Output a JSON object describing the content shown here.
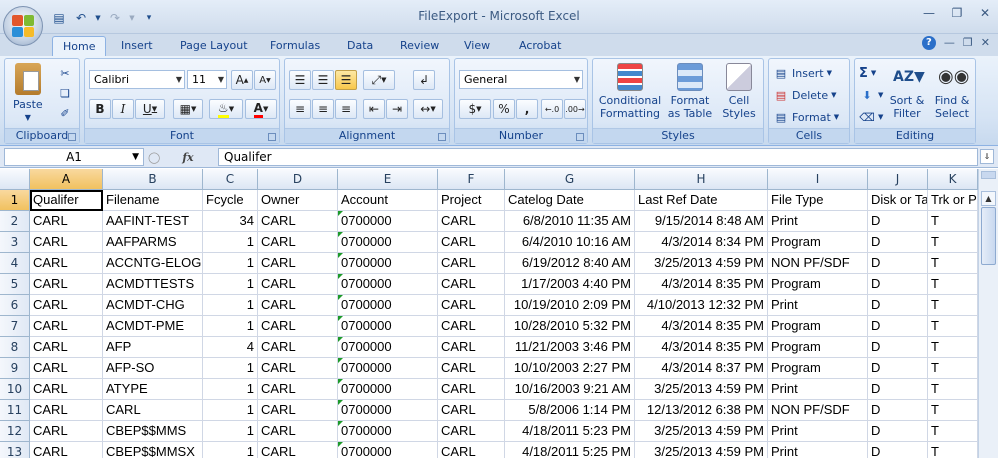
{
  "window": {
    "title": "FileExport - Microsoft Excel"
  },
  "ribbon_tabs": [
    "Home",
    "Insert",
    "Page Layout",
    "Formulas",
    "Data",
    "Review",
    "View",
    "Acrobat"
  ],
  "active_tab": "Home",
  "clipboard": {
    "paste": "Paste",
    "label": "Clipboard"
  },
  "font": {
    "family": "Calibri",
    "size": "11",
    "label": "Font"
  },
  "alignment": {
    "label": "Alignment"
  },
  "number": {
    "format": "General",
    "label": "Number",
    "currency": "$",
    "percent": "%",
    "comma": ","
  },
  "styles": {
    "conditional": "Conditional Formatting",
    "format_table": "Format as Table",
    "cell_styles": "Cell Styles",
    "label": "Styles"
  },
  "cells": {
    "insert": "Insert",
    "delete": "Delete",
    "format": "Format",
    "label": "Cells"
  },
  "editing": {
    "sum": "Σ",
    "sort": "Sort & Filter",
    "find": "Find & Select",
    "label": "Editing"
  },
  "formula_bar": {
    "name_box": "A1",
    "fx": "fx",
    "content": "Qualifer"
  },
  "sheet": {
    "columns": [
      "A",
      "B",
      "C",
      "D",
      "E",
      "F",
      "G",
      "H",
      "I",
      "J",
      "K"
    ],
    "rows": [
      [
        "Qualifer",
        "Filename",
        "Fcycle",
        "Owner",
        "Account",
        "Project",
        "Catelog Date",
        "Last Ref Date",
        "File Type",
        "Disk or Ta",
        "Trk or P"
      ],
      [
        "CARL",
        "AAFINT-TEST",
        "34",
        "CARL",
        "0700000",
        "CARL",
        "6/8/2010 11:35 AM",
        "9/15/2014 8:48 AM",
        "Print",
        "D",
        "T"
      ],
      [
        "CARL",
        "AAFPARMS",
        "1",
        "CARL",
        "0700000",
        "CARL",
        "6/4/2010 10:16 AM",
        "4/3/2014 8:34 PM",
        "Program",
        "D",
        "T"
      ],
      [
        "CARL",
        "ACCNTG-ELOG",
        "1",
        "CARL",
        "0700000",
        "CARL",
        "6/19/2012 8:40 AM",
        "3/25/2013 4:59 PM",
        "NON PF/SDF",
        "D",
        "T"
      ],
      [
        "CARL",
        "ACMDTTESTS",
        "1",
        "CARL",
        "0700000",
        "CARL",
        "1/17/2003 4:40 PM",
        "4/3/2014 8:35 PM",
        "Program",
        "D",
        "T"
      ],
      [
        "CARL",
        "ACMDT-CHG",
        "1",
        "CARL",
        "0700000",
        "CARL",
        "10/19/2010 2:09 PM",
        "4/10/2013 12:32 PM",
        "Print",
        "D",
        "T"
      ],
      [
        "CARL",
        "ACMDT-PME",
        "1",
        "CARL",
        "0700000",
        "CARL",
        "10/28/2010 5:32 PM",
        "4/3/2014 8:35 PM",
        "Program",
        "D",
        "T"
      ],
      [
        "CARL",
        "AFP",
        "4",
        "CARL",
        "0700000",
        "CARL",
        "11/21/2003 3:46 PM",
        "4/3/2014 8:35 PM",
        "Program",
        "D",
        "T"
      ],
      [
        "CARL",
        "AFP-SO",
        "1",
        "CARL",
        "0700000",
        "CARL",
        "10/10/2003 2:27 PM",
        "4/3/2014 8:37 PM",
        "Program",
        "D",
        "T"
      ],
      [
        "CARL",
        "ATYPE",
        "1",
        "CARL",
        "0700000",
        "CARL",
        "10/16/2003 9:21 AM",
        "3/25/2013 4:59 PM",
        "Print",
        "D",
        "T"
      ],
      [
        "CARL",
        "CARL",
        "1",
        "CARL",
        "0700000",
        "CARL",
        "5/8/2006 1:14 PM",
        "12/13/2012 6:38 PM",
        "NON PF/SDF",
        "D",
        "T"
      ],
      [
        "CARL",
        "CBEP$$MMS",
        "1",
        "CARL",
        "0700000",
        "CARL",
        "4/18/2011 5:23 PM",
        "3/25/2013 4:59 PM",
        "Print",
        "D",
        "T"
      ],
      [
        "CARL",
        "CBEP$$MMSX",
        "1",
        "CARL",
        "0700000",
        "CARL",
        "4/18/2011 5:25 PM",
        "3/25/2013 4:59 PM",
        "Print",
        "D",
        "T"
      ]
    ]
  },
  "colors": {
    "active_header": "#f1c15f",
    "ribbon": "#dbe7f6",
    "accent": "#15428b"
  }
}
